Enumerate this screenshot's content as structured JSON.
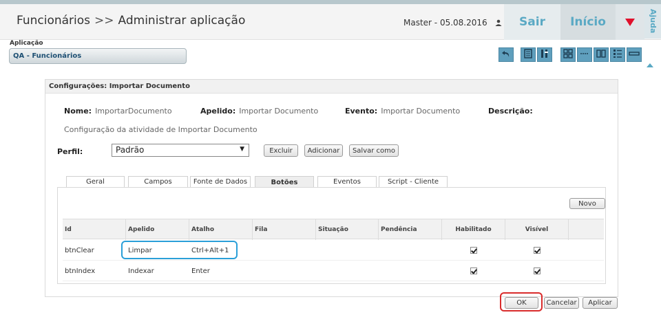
{
  "header": {
    "app_name": "Funcionários",
    "separator": ">>",
    "page": "Administrar aplicação",
    "user": "Master - 05.08.2016",
    "sair_label": "Sair",
    "inicio_label": "Início",
    "ajuda_label": "Ajuda",
    "accent_color": "#5aa9c4",
    "menu_arrow_color": "#e0102b"
  },
  "application": {
    "label": "Aplicação",
    "value": "QA - Funcionários"
  },
  "toolbar": {
    "icons": [
      "undo-icon",
      "document-icon",
      "tools-icon",
      "grid-icon",
      "separator-line-icon",
      "pages-icon",
      "list-icon",
      "bar-icon"
    ]
  },
  "panel": {
    "title": "Configurações: Importar Documento",
    "nome_label": "Nome:",
    "nome_value": "ImportarDocumento",
    "apelido_label": "Apelido:",
    "apelido_value": "Importar Documento",
    "evento_label": "Evento:",
    "evento_value": "Importar Documento",
    "descricao_label": "Descrição:",
    "descricao_text": "Configuração da atividade de Importar Documento",
    "perfil_label": "Perfil:",
    "perfil_value": "Padrão",
    "excluir_label": "Excluir",
    "adicionar_label": "Adicionar",
    "salvar_como_label": "Salvar como"
  },
  "tabs": [
    {
      "label": "Geral"
    },
    {
      "label": "Campos"
    },
    {
      "label": "Fonte de Dados"
    },
    {
      "label": "Botões"
    },
    {
      "label": "Eventos"
    },
    {
      "label": "Script - Cliente"
    }
  ],
  "grid": {
    "novo_label": "Novo",
    "columns": [
      "Id",
      "Apelido",
      "Atalho",
      "Fila",
      "Situação",
      "Pendência",
      "Habilitado",
      "Visível"
    ],
    "rows": [
      {
        "id": "btnClear",
        "apelido": "Limpar",
        "atalho": "Ctrl+Alt+1",
        "fila": "",
        "situacao": "",
        "pendencia": "",
        "habilitado": true,
        "visivel": true
      },
      {
        "id": "btnIndex",
        "apelido": "Indexar",
        "atalho": "Enter",
        "fila": "",
        "situacao": "",
        "pendencia": "",
        "habilitado": true,
        "visivel": true
      }
    ]
  },
  "footer": {
    "ok_label": "OK",
    "cancelar_label": "Cancelar",
    "aplicar_label": "Aplicar"
  }
}
